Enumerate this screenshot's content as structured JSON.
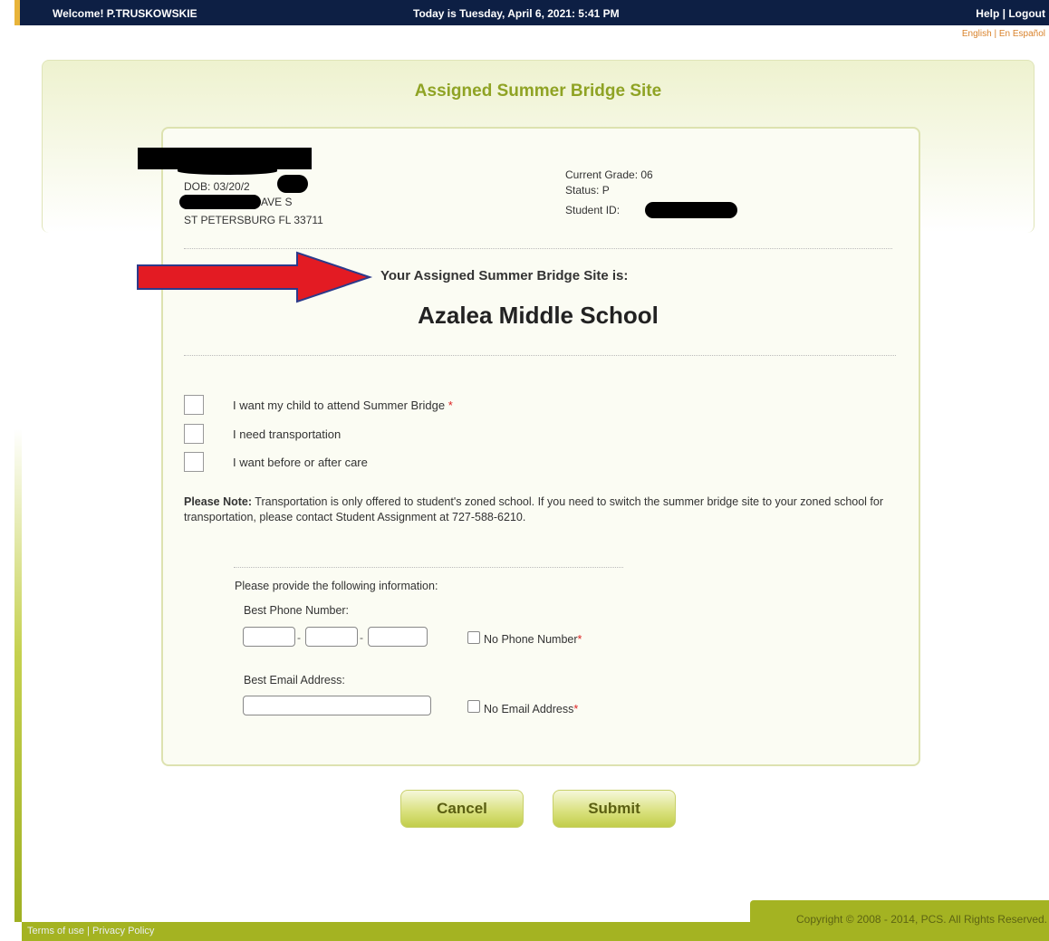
{
  "header": {
    "welcome": "Welcome! P.TRUSKOWSKIE",
    "today": "Today is Tuesday, April 6, 2021: 5:41 PM",
    "help": "Help",
    "separator": "|",
    "logout": "Logout",
    "lang_english": "English",
    "lang_spanish": "En Español"
  },
  "page": {
    "title": "Assigned Summer Bridge Site"
  },
  "student": {
    "dob": "DOB: 03/20/2",
    "address_line": "AVE S",
    "city_line": "ST PETERSBURG FL 33711",
    "current_grade": "Current Grade:  06",
    "status": "Status:  P",
    "student_id_label": "Student ID:"
  },
  "assignment": {
    "label": "Your Assigned Summer Bridge Site is:",
    "site": "Azalea Middle School"
  },
  "options": [
    {
      "label": "I want my child to attend Summer Bridge",
      "required": "*"
    },
    {
      "label": "I need transportation"
    },
    {
      "label": "I want before or after care"
    }
  ],
  "note": {
    "bold": "Please Note:",
    "text": " Transportation is only offered to student's zoned school. If you need to switch the summer bridge site to your zoned school for transportation, please contact Student Assignment at 727-588-6210."
  },
  "contact": {
    "intro": "Please provide the following information:",
    "phone_label": "Best Phone Number:",
    "dash": "-",
    "no_phone": "No Phone Number",
    "email_label": "Best Email Address:",
    "no_email": "No Email Address",
    "required": "*"
  },
  "buttons": {
    "cancel": "Cancel",
    "submit": "Submit"
  },
  "footer": {
    "terms": "Terms of use",
    "separator": "|",
    "privacy": "Privacy Policy",
    "copyright": "Copyright © 2008 - 2014, PCS. All Rights Reserved."
  },
  "colors": {
    "topbar": "#0d1f44",
    "accent_green": "#a4b322",
    "title_green": "#8fa324",
    "arrow_red": "#e31b23"
  }
}
